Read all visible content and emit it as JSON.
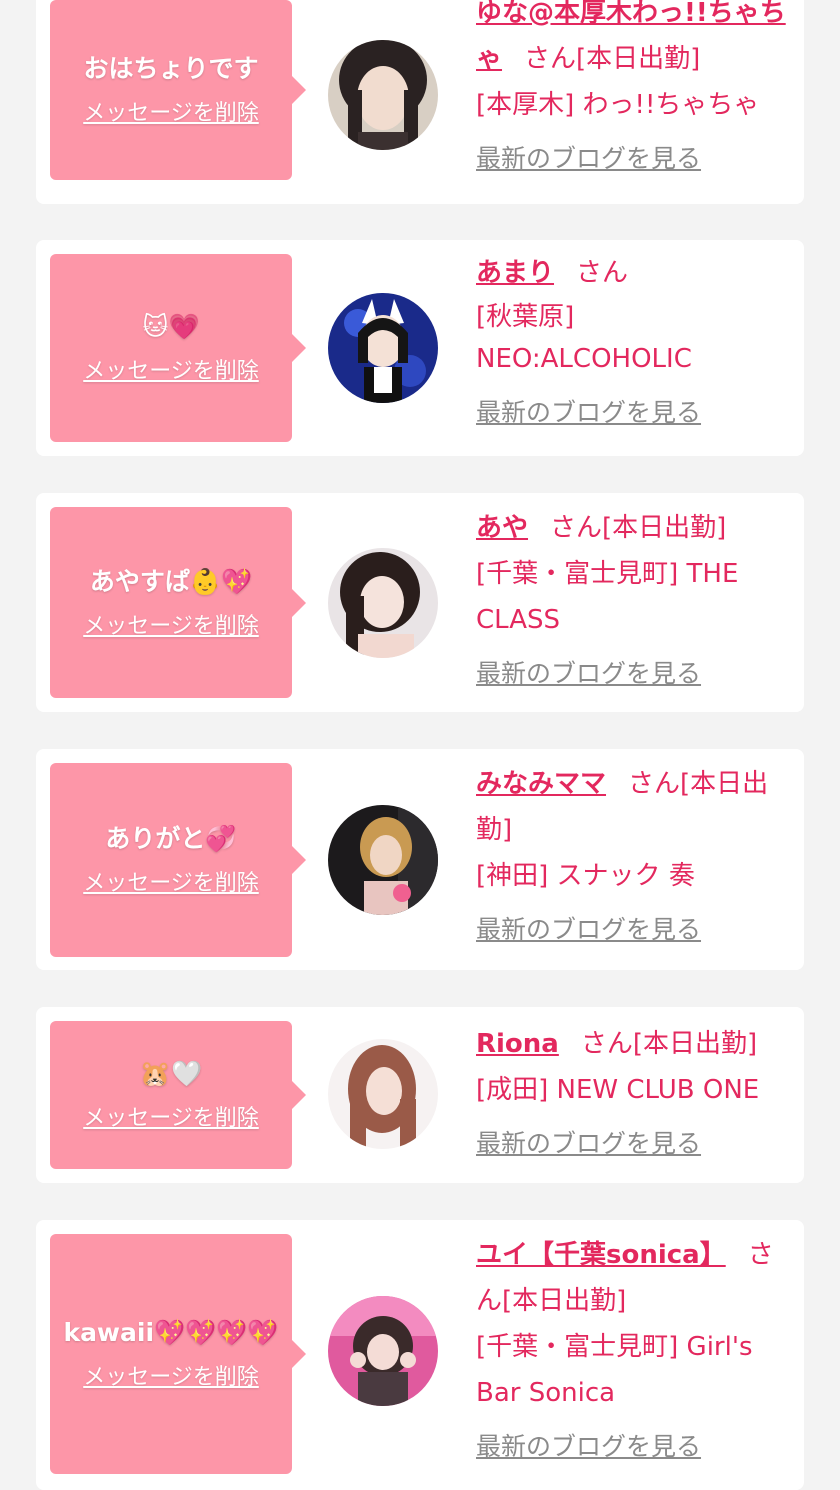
{
  "cards": [
    {
      "message": "おはちょりです",
      "delete_label": "メッセージを削除",
      "name": "ゆな@本厚木わっ!!ちゃちゃ",
      "honorific": "さん",
      "status": "[本日出勤]",
      "shop": "[本厚木] わっ!!ちゃちゃ",
      "blog_label": "最新のブログを見る"
    },
    {
      "message": "🐱💗",
      "delete_label": "メッセージを削除",
      "name": "あまり",
      "honorific": "さん",
      "status": "",
      "shop": "[秋葉原] NEO:ALCOHOLIC",
      "blog_label": "最新のブログを見る"
    },
    {
      "message": "あやすぱ👶💖",
      "delete_label": "メッセージを削除",
      "name": "あや",
      "honorific": "さん",
      "status": "[本日出勤]",
      "shop": "[千葉・富士見町] THE CLASS",
      "blog_label": "最新のブログを見る"
    },
    {
      "message": "ありがと💞",
      "delete_label": "メッセージを削除",
      "name": "みなみママ",
      "honorific": "さん",
      "status": "[本日出勤]",
      "shop": "[神田] スナック 奏",
      "blog_label": "最新のブログを見る"
    },
    {
      "message": "🐹🤍",
      "delete_label": "メッセージを削除",
      "name": "Riona",
      "honorific": "さん",
      "status": "[本日出勤]",
      "shop": "[成田] NEW CLUB ONE",
      "blog_label": "最新のブログを見る"
    },
    {
      "message": "kawaii💖💖💖💖",
      "delete_label": "メッセージを削除",
      "name": "ユイ【千葉sonica】",
      "honorific": "さん",
      "status": "[本日出勤]",
      "shop": "[千葉・富士見町] Girl's Bar Sonica",
      "blog_label": "最新のブログを見る"
    }
  ],
  "colors": {
    "page_bg": "#f3f3f3",
    "bubble": "#fd96a8",
    "accent": "#e3285e",
    "link_gray": "#8a8a8a"
  }
}
